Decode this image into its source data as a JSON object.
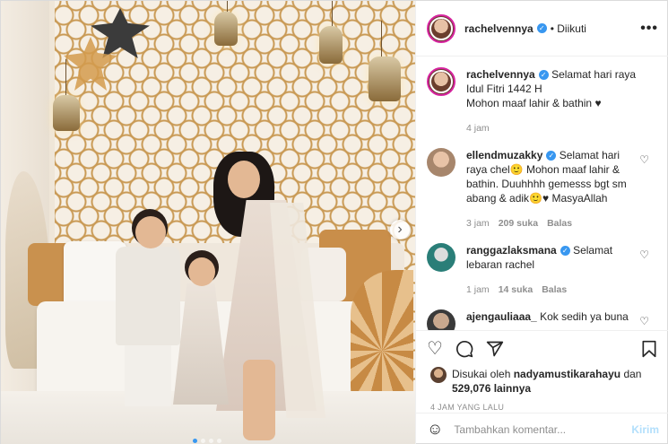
{
  "post": {
    "username": "rachelvennya",
    "follow_status": "Diikuti",
    "more_label": "•••",
    "carousel_next": "›",
    "caption_line1": "Selamat hari raya Idul Fitri 1442 H",
    "caption_line2": "Mohon maaf lahir & bathin",
    "caption_emoji": "♥",
    "caption_time": "4 jam"
  },
  "comments": [
    {
      "username": "ellendmuzakky",
      "text": "Selamat hari raya chel🙂 Mohon maaf lahir & bathin. Duuhhhh gemesss bgt sm abang & adik🙂♥ MasyaAllah",
      "time": "3 jam",
      "likes": "209 suka",
      "reply": "Balas"
    },
    {
      "username": "ranggazlaksmana",
      "text": "Selamat lebaran rachel",
      "time": "1 jam",
      "likes": "14 suka",
      "reply": "Balas"
    },
    {
      "username": "ajengauliaaa_",
      "text": "Kok sedih ya buna",
      "time": "",
      "likes": "",
      "reply": ""
    }
  ],
  "likes": {
    "prefix": "Disukai oleh",
    "by_user": "nadyamustikarahayu",
    "mid": "dan",
    "count": "529,076 lainnya"
  },
  "timestamp": "4 JAM YANG LALU",
  "composer": {
    "placeholder": "Tambahkan komentar...",
    "send_label": "Kirim"
  },
  "colors": {
    "verified": "#3897f0",
    "meta_gray": "#8e8e8e",
    "send_disabled": "#b2dffc",
    "story_ring": "#d6249f"
  }
}
